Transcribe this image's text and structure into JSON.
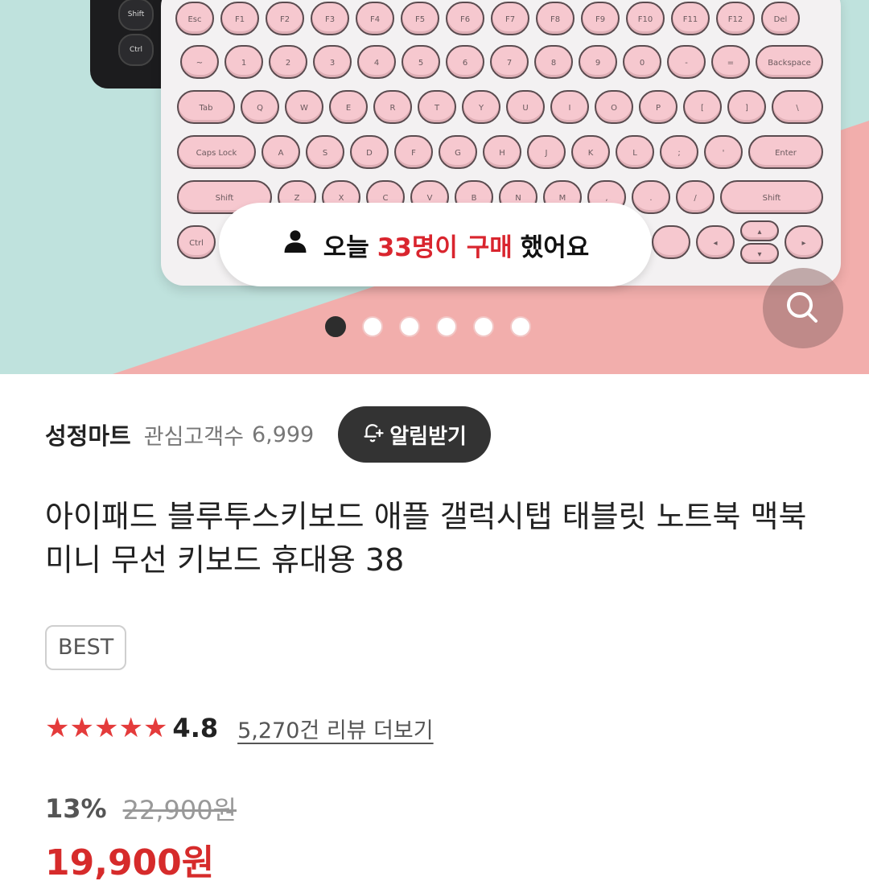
{
  "hero": {
    "purchase_notice": {
      "prefix": "오늘",
      "highlight": "33명이 구매",
      "suffix": "했어요"
    },
    "carousel": {
      "total": 6,
      "active_index": 0
    },
    "zoom_icon": "magnifier-icon"
  },
  "seller": {
    "name": "성정마트",
    "followers_label": "관심고객수",
    "followers_count": "6,999",
    "alert_button_label": "알림받기",
    "alert_icon": "bell-plus-icon"
  },
  "product": {
    "title": "아이패드 블루투스키보드 애플 갤럭시탭 태블릿 노트북 맥북 미니 무선 키보드 휴대용 38",
    "badge": "BEST",
    "rating": {
      "stars": 5,
      "value": "4.8",
      "reviews_link": "5,270건 리뷰 더보기"
    },
    "price": {
      "discount": "13%",
      "original": "22,900원",
      "sale": "19,900원"
    }
  },
  "colors": {
    "accent_red": "#d9252e",
    "star_red": "#e43b3b",
    "button_dark": "#333333"
  }
}
